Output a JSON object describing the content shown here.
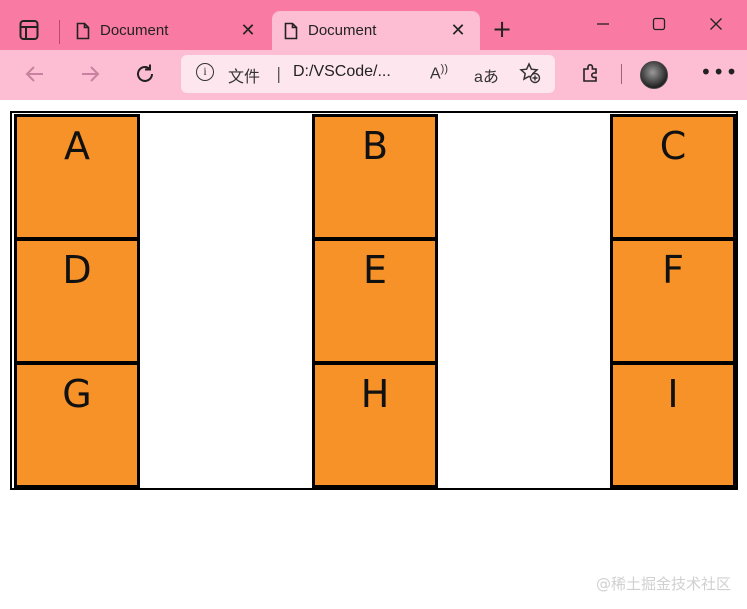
{
  "tabs": [
    {
      "label": "Document",
      "active": false
    },
    {
      "label": "Document",
      "active": true
    }
  ],
  "address_bar": {
    "label": "文件",
    "separator": "|",
    "url": "D:/VSCode/...",
    "read_aloud": "A̅",
    "translate": "aあ"
  },
  "colors": {
    "titlebar": "#f97ba4",
    "toolbar": "#fdbdd3",
    "cell": "#f79229"
  },
  "grid": {
    "cells": [
      "A",
      "B",
      "C",
      "D",
      "E",
      "F",
      "G",
      "H",
      "I"
    ]
  },
  "watermark": "@稀土掘金技术社区"
}
